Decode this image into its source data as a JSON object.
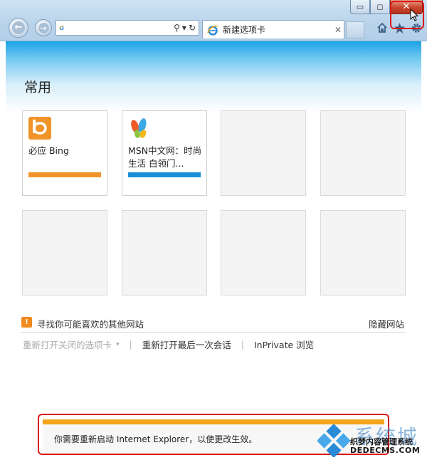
{
  "window": {
    "minimize_glyph": "▭",
    "restore_glyph": "◻",
    "close_glyph": "✕"
  },
  "toolbar": {
    "address_value": "",
    "back_icon": "back-arrow-icon",
    "forward_icon": "forward-arrow-icon",
    "search_glyph": "⚲",
    "dropdown_glyph": "▾",
    "refresh_glyph": "↻"
  },
  "tab": {
    "label": "新建选项卡",
    "close_glyph": "✕"
  },
  "main": {
    "heading": "常用",
    "tiles": [
      {
        "label": "必应 Bing",
        "bar_color": "#f0942a"
      },
      {
        "label": "MSN中文网：时尚生活 白领门...",
        "bar_color": "#1a8fd6"
      }
    ],
    "suggest_icon": "!",
    "suggest_text": "寻找你可能喜欢的其他网站",
    "hide_link": "隐藏网站",
    "reopen_closed_tabs": "重新打开关闭的选项卡",
    "reopen_dropdown": "▾",
    "separator": "|",
    "reopen_last_session": "重新打开最后一次会话",
    "inprivate": "InPrivate 浏览"
  },
  "notification": {
    "text": "你需要重新启动 Internet Explorer，以使更改生效。",
    "accent_color": "#f2a51d"
  },
  "watermark": {
    "big_text": "系统城",
    "line1": "织梦内容管理系统",
    "line2": "DEDECMS.COM"
  }
}
